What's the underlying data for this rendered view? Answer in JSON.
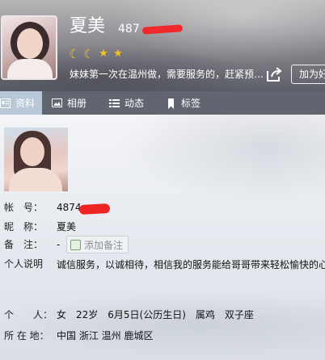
{
  "header": {
    "nickname": "夏美",
    "account_visible": "487",
    "level_icons": [
      "moon-icon",
      "moon-icon",
      "star-icon",
      "star-icon"
    ],
    "signature": "妹妹第一次在温州做，需要服务的，赶紧预…",
    "add_friend_label": "加为好友",
    "colors": {
      "level": "#f5c21b",
      "redaction": "#f02a2a"
    }
  },
  "tabs": [
    {
      "label": "资料",
      "icon": "profile-card-icon",
      "active": true
    },
    {
      "label": "相册",
      "icon": "photo-album-icon",
      "active": false
    },
    {
      "label": "动态",
      "icon": "feed-list-icon",
      "active": false
    },
    {
      "label": "标签",
      "icon": "bookmark-icon",
      "active": false
    }
  ],
  "profile": {
    "fields": {
      "account": {
        "label": "帐　号：",
        "value": "4874"
      },
      "nickname": {
        "label": "昵　称：",
        "value": "夏美"
      },
      "note": {
        "label": "备　注：",
        "value": "-",
        "button": "添加备注"
      },
      "intro": {
        "label": "个人说明",
        "value": "诚信服务，以诚相待，相信我的服务能给哥哥带来轻松愉快的心情"
      },
      "personal": {
        "label": "个　　人：",
        "value": "女　22岁　6月5日(公历生日)　属鸡　双子座"
      },
      "location": {
        "label": "所 在 地：",
        "value": "中国 浙江 温州 鹿城区"
      }
    }
  }
}
